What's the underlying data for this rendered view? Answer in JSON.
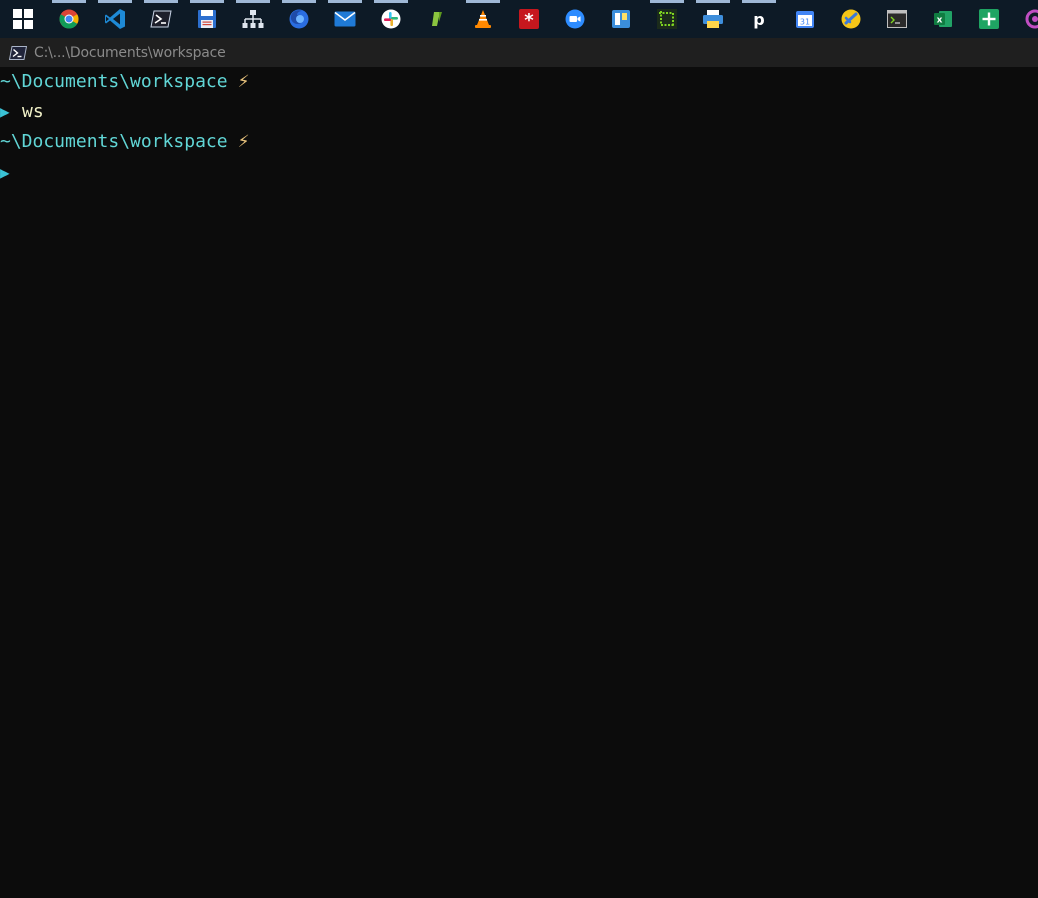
{
  "taskbar": {
    "items": [
      {
        "name": "windows-start-icon",
        "running": false
      },
      {
        "name": "chrome-icon",
        "running": true
      },
      {
        "name": "vscode-icon",
        "running": true
      },
      {
        "name": "powershell-icon",
        "running": true
      },
      {
        "name": "save-disk-icon",
        "running": true
      },
      {
        "name": "network-tree-icon",
        "running": true
      },
      {
        "name": "firefox-icon",
        "running": true
      },
      {
        "name": "mail-icon",
        "running": true
      },
      {
        "name": "slack-icon",
        "running": true
      },
      {
        "name": "green-app-icon",
        "running": false
      },
      {
        "name": "vlc-icon",
        "running": true
      },
      {
        "name": "red-asterisk-app-icon",
        "running": false
      },
      {
        "name": "zoom-icon",
        "running": false
      },
      {
        "name": "blue-board-app-icon",
        "running": false
      },
      {
        "name": "green-crop-app-icon",
        "running": true
      },
      {
        "name": "printer-app-icon",
        "running": true
      },
      {
        "name": "p-app-icon",
        "running": true
      },
      {
        "name": "calendar-icon",
        "running": false
      },
      {
        "name": "yellow-round-app-icon",
        "running": false
      },
      {
        "name": "terminal-app-icon",
        "running": false
      },
      {
        "name": "excel-icon",
        "running": false
      },
      {
        "name": "sheets-plus-icon",
        "running": false
      },
      {
        "name": "purple-app-icon",
        "running": false
      }
    ],
    "calendar_day": "31"
  },
  "window": {
    "title": "C:\\...\\Documents\\workspace"
  },
  "terminal": {
    "lines": [
      {
        "path": "~\\Documents\\workspace",
        "bolt": "⚡"
      },
      {
        "arrow": "▶",
        "command": "ws"
      },
      {
        "path": "~\\Documents\\workspace",
        "bolt": "⚡"
      },
      {
        "arrow": "▶",
        "command": ""
      }
    ]
  },
  "colors": {
    "taskbar_bg": "#0d1a26",
    "titlebar_bg": "#1f1f1f",
    "terminal_bg": "#0c0c0c",
    "path_color": "#61d6d6",
    "prompt_arrow_color": "#3ac3d6",
    "bolt_color": "#e5c07b"
  }
}
